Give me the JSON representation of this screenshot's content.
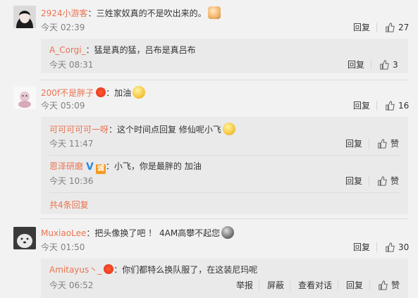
{
  "comments": [
    {
      "user": "2924小游客",
      "text": "三姓家奴真的不是吹出来的。",
      "time": "今天 02:39",
      "reply_label": "回复",
      "likes": "27",
      "avatar_icon": "girl-portrait",
      "emoji_icon": "clap-emoji",
      "replies": [
        {
          "user": "A_Corgi_",
          "text": "猛是真的猛，吕布是真吕布",
          "time": "今天 08:31",
          "reply_label": "回复",
          "likes": "3"
        }
      ]
    },
    {
      "user": "200f不是胖子",
      "text": "加油",
      "time": "今天 05:09",
      "reply_label": "回复",
      "likes": "16",
      "avatar_icon": "pink-cartoon",
      "emoji_icon": "cheer-emoji",
      "replies": [
        {
          "user": "可可可可可一呀",
          "text": "这个时间点回复 修仙呢小飞",
          "time": "今天 11:47",
          "reply_label": "回复",
          "likes": "赞"
        },
        {
          "user": "恩泽研磨",
          "badge_text": "诚",
          "text": "小飞，你是最胖的 加油",
          "time": "今天 10:36",
          "reply_label": "回复",
          "likes": "赞"
        }
      ],
      "more_replies": "共4条回复"
    },
    {
      "user": "MuxiaoLee",
      "text": "把头像换了吧 ！ 4AM高攀不起您",
      "time": "今天 01:50",
      "reply_label": "回复",
      "likes": "30",
      "avatar_icon": "dog-photo",
      "emoji_icon": "dark-emoji",
      "replies": [
        {
          "user": "Amitayus丶_",
          "text": "你们都特么换队服了，在这装尼玛呢",
          "time": "今天 06:52",
          "report": "举报",
          "block": "屏蔽",
          "view": "查看对话",
          "reply_label": "回复",
          "likes": "赞"
        }
      ]
    }
  ],
  "colors": {
    "username": "#eb7350",
    "page_bg": "#f2f2f2",
    "reply_bg": "#eaeaea",
    "muted": "#808080"
  }
}
